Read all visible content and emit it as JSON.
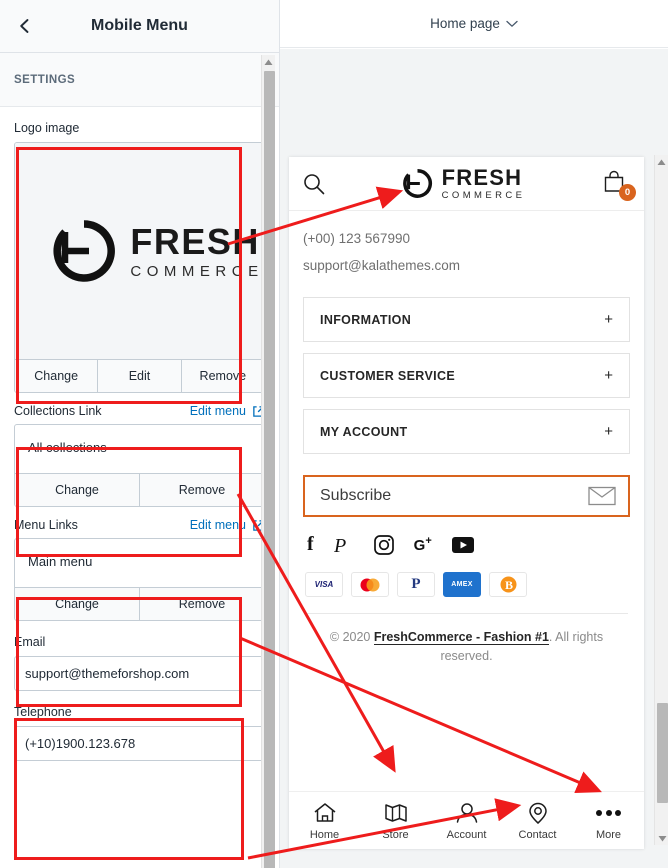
{
  "sidebar": {
    "back_icon": "chevron-left-icon",
    "title": "Mobile Menu",
    "section_label": "SETTINGS",
    "logo_field": {
      "label": "Logo image",
      "actions": [
        "Change",
        "Edit",
        "Remove"
      ],
      "logo_primary": "FRESH",
      "logo_secondary": "COMMERCE"
    },
    "collections_field": {
      "label": "Collections Link",
      "edit_link": "Edit menu",
      "value": "All collections",
      "actions": [
        "Change",
        "Remove"
      ]
    },
    "menu_field": {
      "label": "Menu Links",
      "edit_link": "Edit menu",
      "value": "Main menu",
      "actions": [
        "Change",
        "Remove"
      ]
    },
    "email_field": {
      "label": "Email",
      "value": "support@themeforshop.com"
    },
    "telephone_field": {
      "label": "Telephone",
      "value": "(+10)1900.123.678"
    }
  },
  "preview": {
    "page_selector": "Home page",
    "chevron_icon": "chevron-down-icon",
    "store": {
      "search_icon": "search-icon",
      "logo_primary": "FRESH",
      "logo_secondary": "COMMERCE",
      "cart_icon": "shopping-bag-icon",
      "cart_count": "0",
      "phone": "(+00) 123 567990",
      "email": "support@kalathemes.com",
      "accordions": [
        {
          "title": "INFORMATION",
          "toggle": "+"
        },
        {
          "title": "CUSTOMER SERVICE",
          "toggle": "+"
        },
        {
          "title": "MY ACCOUNT",
          "toggle": "+"
        }
      ],
      "subscribe": {
        "placeholder": "Subscribe",
        "icon": "envelope-icon"
      },
      "socials": [
        "facebook-icon",
        "pinterest-icon",
        "instagram-icon",
        "google-plus-icon",
        "youtube-icon"
      ],
      "payments": [
        "VISA",
        "mastercard",
        "PayPal",
        "AMEX",
        "bitcoin"
      ],
      "copyright_prefix": "© 2020 ",
      "copyright_brand": "FreshCommerce - Fashion #1",
      "copyright_suffix": ". All rights reserved.",
      "bottom_nav": [
        {
          "label": "Home",
          "icon": "home-icon"
        },
        {
          "label": "Store",
          "icon": "map-icon"
        },
        {
          "label": "Account",
          "icon": "person-icon"
        },
        {
          "label": "Contact",
          "icon": "location-pin-icon"
        },
        {
          "label": "More",
          "icon": "ellipsis-icon"
        }
      ]
    }
  },
  "colors": {
    "annotation": "#ee1c1c",
    "link": "#006fbb",
    "accent": "#d9641e",
    "panel_bg": "#f4f6f8",
    "text": "#212b36"
  }
}
